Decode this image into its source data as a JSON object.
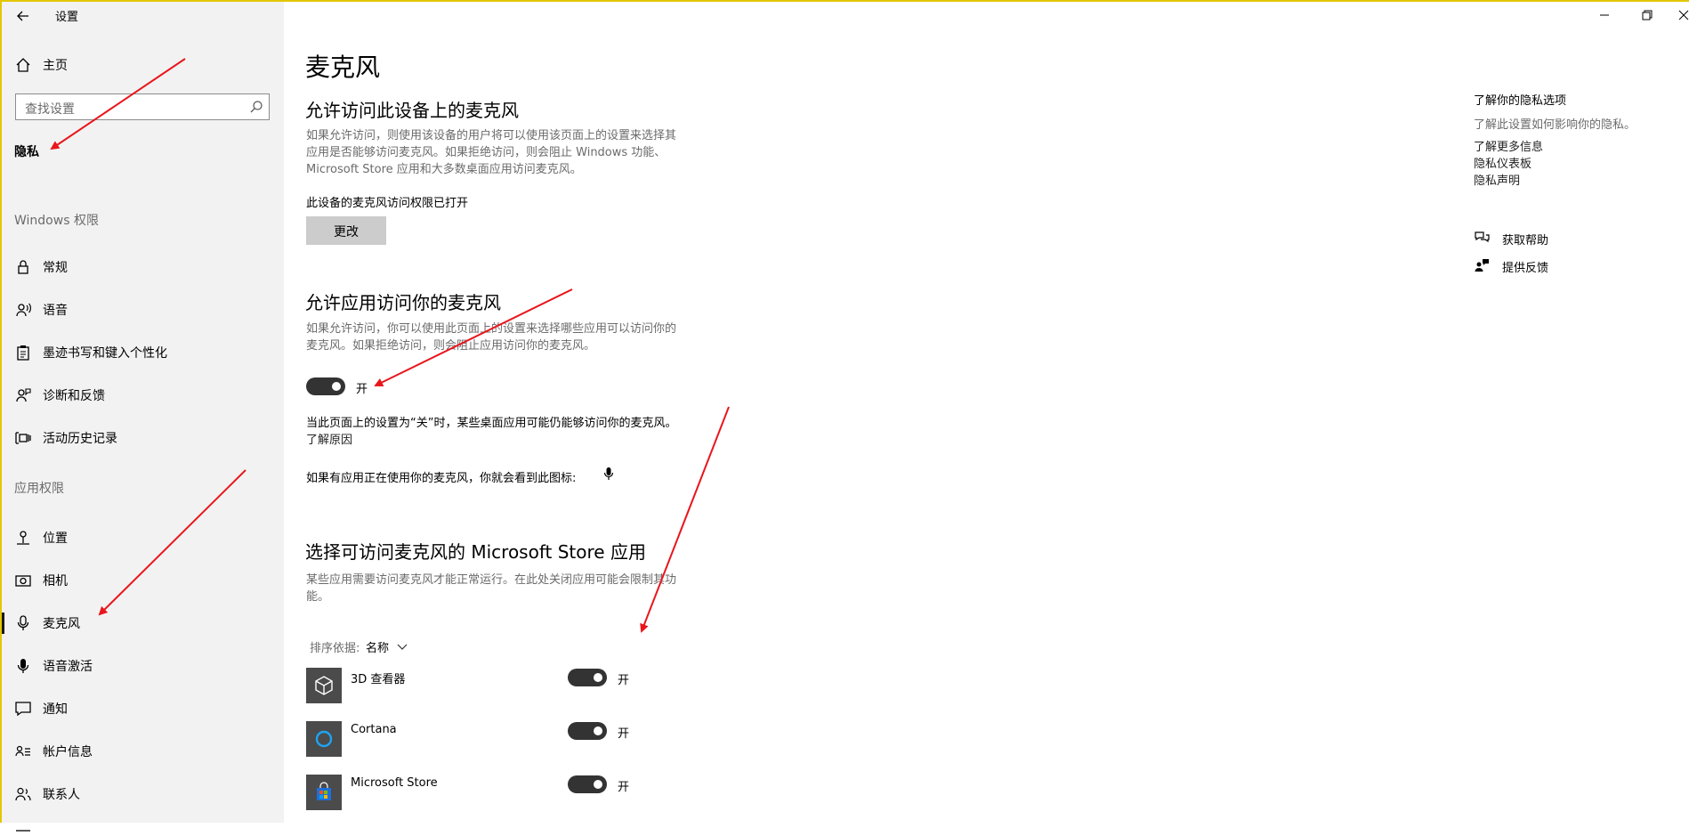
{
  "window": {
    "title": "设置",
    "back_icon": "back-arrow-icon",
    "controls": [
      "minimize-icon",
      "restore-icon",
      "close-icon"
    ]
  },
  "sidebar": {
    "home": {
      "label": "主页",
      "icon": "home-icon"
    },
    "search_placeholder": "查找设置",
    "current": "隐私",
    "sections": {
      "windows_perms": "Windows 权限",
      "app_perms": "应用权限"
    },
    "windows_items": [
      {
        "label": "常规",
        "icon": "lock-icon"
      },
      {
        "label": "语音",
        "icon": "speech-icon"
      },
      {
        "label": "墨迹书写和键入个性化",
        "icon": "clipboard-icon"
      },
      {
        "label": "诊断和反馈",
        "icon": "feedback-person-icon"
      },
      {
        "label": "活动历史记录",
        "icon": "timeline-icon"
      }
    ],
    "app_items": [
      {
        "label": "位置",
        "icon": "location-icon"
      },
      {
        "label": "相机",
        "icon": "camera-icon"
      },
      {
        "label": "麦克风",
        "icon": "microphone-icon",
        "selected": true
      },
      {
        "label": "语音激活",
        "icon": "voice-activation-icon"
      },
      {
        "label": "通知",
        "icon": "notification-icon"
      },
      {
        "label": "帐户信息",
        "icon": "account-info-icon"
      },
      {
        "label": "联系人",
        "icon": "contacts-icon"
      }
    ]
  },
  "main": {
    "page_title": "麦克风",
    "device_access": {
      "heading": "允许访问此设备上的麦克风",
      "desc": [
        "如果允许访问，则使用该设备的用户将可以使用该页面上的设置来选择其",
        "应用是否能够访问麦克风。如果拒绝访问，则会阻止 Windows 功能、",
        "Microsoft Store 应用和大多数桌面应用访问麦克风。"
      ],
      "status": "此设备的麦克风访问权限已打开",
      "change_button": "更改"
    },
    "app_access": {
      "heading": "允许应用访问你的麦克风",
      "desc": [
        "如果允许访问，你可以使用此页面上的设置来选择哪些应用可以访问你的",
        "麦克风。如果拒绝访问，则会阻止应用访问你的麦克风。"
      ],
      "toggle_label": "开",
      "toggle_on": true,
      "note": "当此页面上的设置为“关”时，某些桌面应用可能仍能够访问你的麦克风。",
      "learn_link": "了解原因",
      "icon_note": "如果有应用正在使用你的麦克风，你就会看到此图标:"
    },
    "store_apps": {
      "heading": "选择可访问麦克风的 Microsoft Store 应用",
      "desc": [
        "某些应用需要访问麦克风才能正常运行。在此处关闭应用可能会限制其功",
        "能。"
      ],
      "sort_label": "排序依据:",
      "sort_value": "名称",
      "apps": [
        {
          "name": "3D 查看器",
          "icon": "cube-icon",
          "toggle_label": "开",
          "on": true
        },
        {
          "name": "Cortana",
          "icon": "cortana-icon",
          "toggle_label": "开",
          "on": true
        },
        {
          "name": "Microsoft Store",
          "icon": "store-bag-icon",
          "toggle_label": "开",
          "on": true
        }
      ]
    }
  },
  "right_panel": {
    "heading": "了解你的隐私选项",
    "desc": "了解此设置如何影响你的隐私。",
    "links": [
      "了解更多信息",
      "隐私仪表板",
      "隐私声明"
    ],
    "help": {
      "label": "获取帮助",
      "icon": "help-chat-icon"
    },
    "feedback": {
      "label": "提供反馈",
      "icon": "feedback-icon"
    }
  },
  "annotations": {
    "arrow_color": "#e8161c"
  }
}
